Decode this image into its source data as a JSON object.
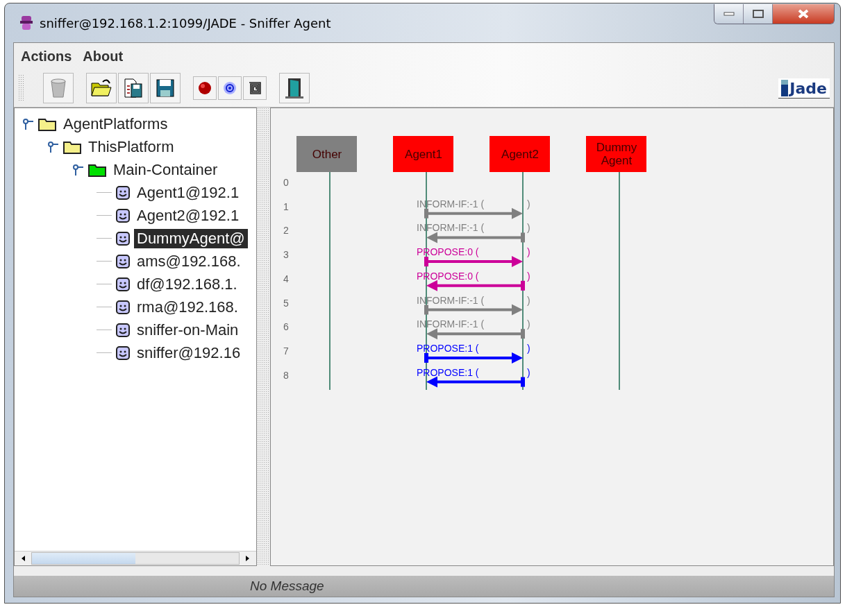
{
  "window": {
    "title": "sniffer@192.168.1.2:1099/JADE - Sniffer Agent"
  },
  "menu": [
    {
      "label": "Actions"
    },
    {
      "label": "About"
    }
  ],
  "logo": {
    "text": "Jade"
  },
  "tree": [
    {
      "label": "AgentPlatforms",
      "kind": "platform",
      "expanded": true,
      "selected": false,
      "children": [
        {
          "label": "ThisPlatform",
          "kind": "platform",
          "expanded": true,
          "selected": false,
          "children": [
            {
              "label": "Main-Container",
              "kind": "container",
              "expanded": true,
              "selected": false,
              "children": [
                {
                  "label": "Agent1@192.1",
                  "kind": "agent",
                  "selected": false
                },
                {
                  "label": "Agent2@192.1",
                  "kind": "agent",
                  "selected": false
                },
                {
                  "label": "DummyAgent@",
                  "kind": "agent",
                  "selected": true
                },
                {
                  "label": "ams@192.168.",
                  "kind": "agent",
                  "selected": false
                },
                {
                  "label": "df@192.168.1.",
                  "kind": "agent",
                  "selected": false
                },
                {
                  "label": "rma@192.168.",
                  "kind": "agent",
                  "selected": false
                },
                {
                  "label": "sniffer-on-Main",
                  "kind": "agent",
                  "selected": false
                },
                {
                  "label": "sniffer@192.16",
                  "kind": "agent",
                  "selected": false
                }
              ]
            }
          ]
        }
      ]
    }
  ],
  "sniffer": {
    "agents": [
      {
        "name": "Other",
        "color": "#808080"
      },
      {
        "name": "Agent1",
        "color": "#ff0000"
      },
      {
        "name": "Agent2",
        "color": "#ff0000"
      },
      {
        "name": "Dummy Agent",
        "color": "#ff0000"
      }
    ],
    "rows": [
      "0",
      "1",
      "2",
      "3",
      "4",
      "5",
      "6",
      "7",
      "8"
    ],
    "messages": [
      {
        "label": "INFORM-IF:-1 (",
        "end": ")",
        "kind": "rightward",
        "color": "#808080"
      },
      {
        "label": "INFORM-IF:-1 (",
        "end": ")",
        "kind": "leftward",
        "color": "#808080"
      },
      {
        "label": "PROPOSE:0 (",
        "end": ")",
        "kind": "rightward",
        "color": "#cc0099"
      },
      {
        "label": "PROPOSE:0 (",
        "end": ")",
        "kind": "leftward",
        "color": "#cc0099"
      },
      {
        "label": "INFORM-IF:-1 (",
        "end": ")",
        "kind": "rightward",
        "color": "#808080"
      },
      {
        "label": "INFORM-IF:-1 (",
        "end": ")",
        "kind": "leftward",
        "color": "#808080"
      },
      {
        "label": "PROPOSE:1 (",
        "end": ")",
        "kind": "rightward",
        "color": "#0000ff"
      },
      {
        "label": "PROPOSE:1 (",
        "end": ")",
        "kind": "leftward",
        "color": "#0000ff"
      }
    ]
  },
  "status_bar": {
    "text": "No Message"
  }
}
